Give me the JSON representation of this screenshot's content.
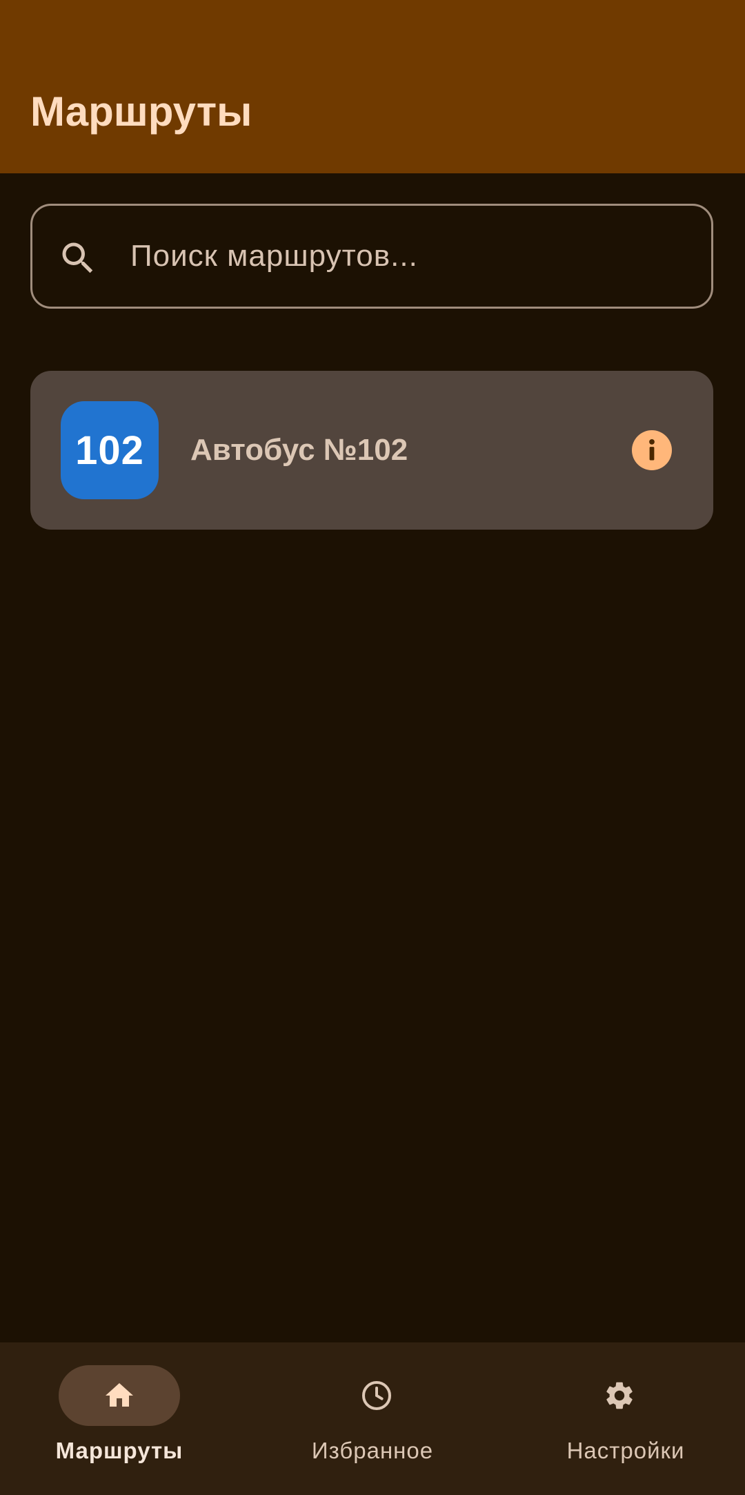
{
  "app_bar": {
    "title": "Маршруты"
  },
  "search": {
    "placeholder": "Поиск маршрутов...",
    "value": "",
    "icon": "search-icon"
  },
  "routes": [
    {
      "number": "102",
      "name": "Автобус №102",
      "badge_color": "#2174d0",
      "action_icon": "info-icon"
    }
  ],
  "bottom_nav": {
    "items": [
      {
        "label": "Маршруты",
        "icon": "home-icon",
        "active": true
      },
      {
        "label": "Избранное",
        "icon": "clock-icon",
        "active": false
      },
      {
        "label": "Настройки",
        "icon": "gear-icon",
        "active": false
      }
    ]
  },
  "colors": {
    "app_bar": "#703a00",
    "background": "#1c1103",
    "card": "#52453d",
    "accent": "#ffb77a",
    "nav_background": "#30200f"
  }
}
